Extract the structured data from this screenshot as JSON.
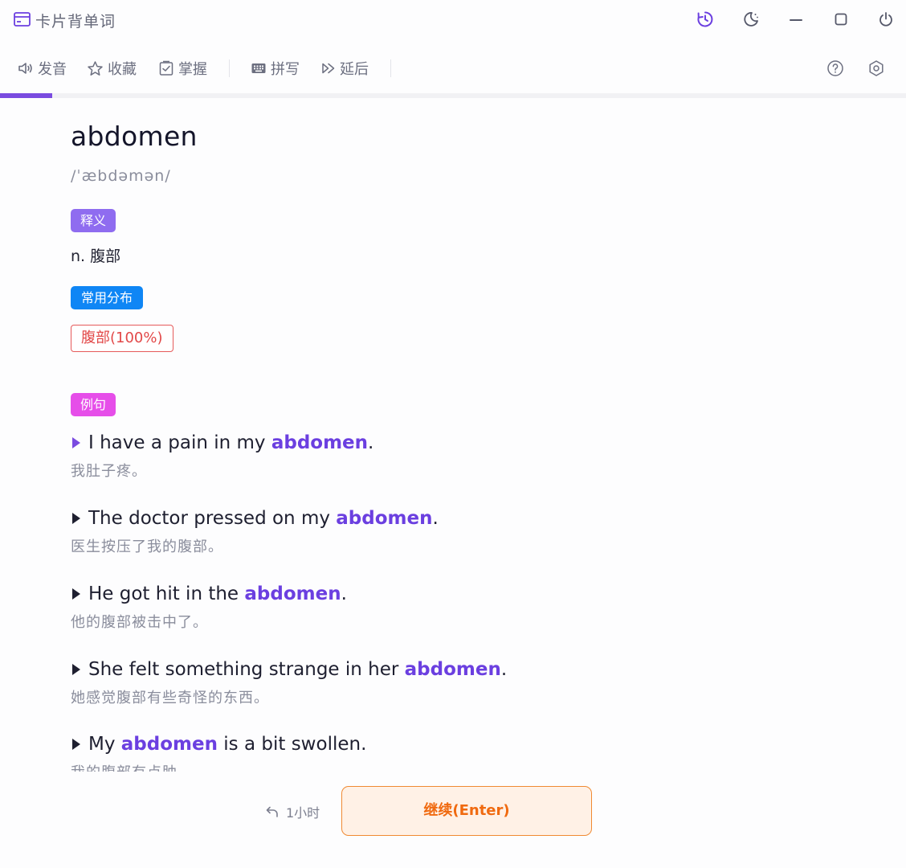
{
  "app": {
    "title": "卡片背单词",
    "icon": "card-icon"
  },
  "window_controls": [
    {
      "name": "history-clock-icon",
      "color": "#6b3fe0"
    },
    {
      "name": "moon-icon"
    },
    {
      "name": "minimize-icon"
    },
    {
      "name": "maximize-icon"
    },
    {
      "name": "power-icon"
    }
  ],
  "toolbar": {
    "pronounce": "发音",
    "favorite": "收藏",
    "master": "掌握",
    "spell": "拼写",
    "delay": "延后"
  },
  "progress": {
    "fraction": 0.058,
    "color": "#7a4be0"
  },
  "card": {
    "word": "abdomen",
    "phonetic": "/ˈæbdəmən/",
    "definition_tag": "释义",
    "definition": "n. 腹部",
    "distribution_tag": "常用分布",
    "distribution_chip": "腹部(100%)",
    "examples_tag": "例句",
    "examples": [
      {
        "pre": "I have a pain in my ",
        "word": "abdomen",
        "post": ".",
        "zh": "我肚子疼。"
      },
      {
        "pre": "The doctor pressed on my ",
        "word": "abdomen",
        "post": ".",
        "zh": "医生按压了我的腹部。"
      },
      {
        "pre": "He got hit in the ",
        "word": "abdomen",
        "post": ".",
        "zh": "他的腹部被击中了。"
      },
      {
        "pre": "She felt something strange in her ",
        "word": "abdomen",
        "post": ".",
        "zh": "她感觉腹部有些奇怪的东西。"
      },
      {
        "pre": "My ",
        "word": "abdomen",
        "post": " is a bit swollen.",
        "zh": "我的腹部有点肿。"
      }
    ]
  },
  "footer": {
    "delay_label": "1小时",
    "continue_label": "继续(Enter)"
  },
  "colors": {
    "accent": "#7a4be0",
    "definition_tag": "#8f6cf0",
    "distribution_tag": "#0f86f5",
    "examples_tag": "#e64ee9",
    "chip_border": "#e65a5a",
    "continue_border": "#f08a33"
  }
}
